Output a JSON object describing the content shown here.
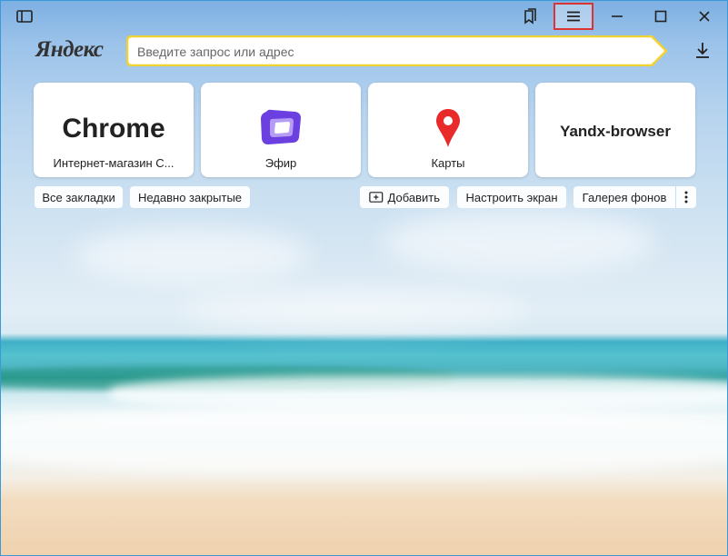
{
  "titlebar": {
    "sidebar_icon": "sidebar-panel-icon",
    "bookmarks_icon": "bookmarks-icon",
    "menu_icon": "hamburger-menu-icon",
    "minimize_icon": "minimize-icon",
    "maximize_icon": "maximize-icon",
    "close_icon": "close-icon"
  },
  "brand": {
    "logo_text": "Яндекс"
  },
  "search": {
    "placeholder": "Введите запрос или адрес",
    "value": ""
  },
  "tiles": [
    {
      "title": "Chrome",
      "caption": "Интернет-магазин C..."
    },
    {
      "title": "",
      "caption": "Эфир",
      "icon": "efir-icon"
    },
    {
      "title": "",
      "caption": "Карты",
      "icon": "maps-pin-icon"
    },
    {
      "title": "Yandx-browser",
      "caption": ""
    }
  ],
  "actions": {
    "all_bookmarks": "Все закладки",
    "recently_closed": "Недавно закрытые",
    "add": "Добавить",
    "customize": "Настроить экран",
    "gallery": "Галерея фонов"
  },
  "colors": {
    "accent_border": "#f2d22e",
    "highlight": "#d33333",
    "efir": "#6b3fe0",
    "maps_pin": "#e82a2a"
  }
}
